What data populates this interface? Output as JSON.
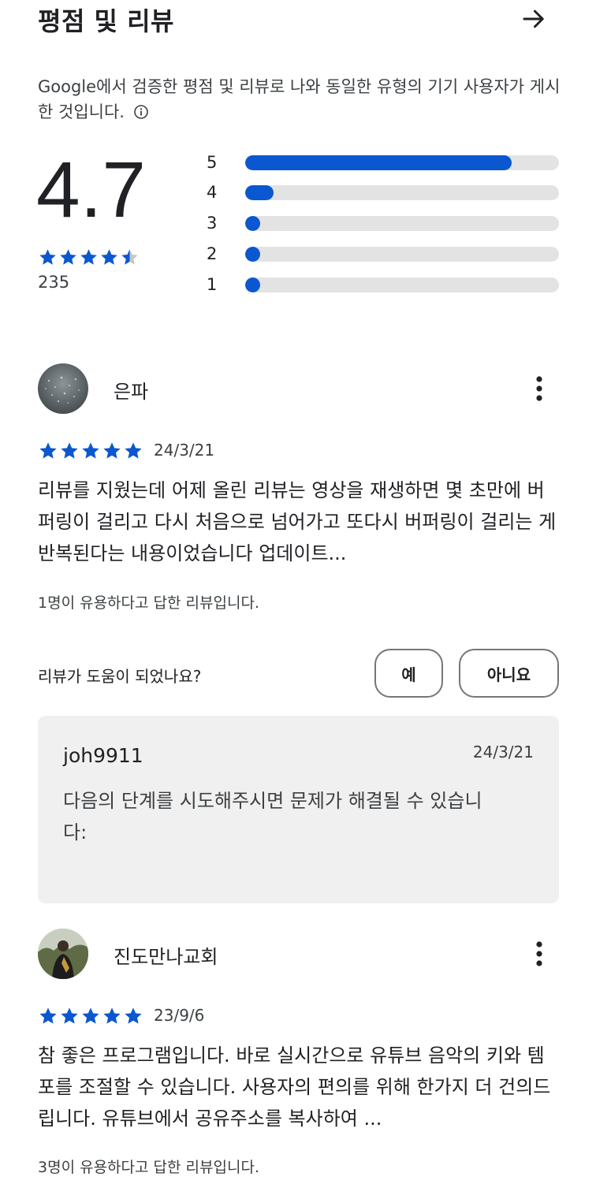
{
  "header": {
    "title": "평점 및 리뷰"
  },
  "description": {
    "text": "Google에서 검증한 평점 및 리뷰로 나와 동일한 유형의 기기 사용자가 게시한 것입니다."
  },
  "summary": {
    "average": "4.7",
    "stars_filled": 4.5,
    "total_count": "235"
  },
  "histogram": [
    {
      "label": "5",
      "fraction": 0.85
    },
    {
      "label": "4",
      "fraction": 0.09
    },
    {
      "label": "3",
      "fraction": 0.02
    },
    {
      "label": "2",
      "fraction": 0.02
    },
    {
      "label": "1",
      "fraction": 0.02
    }
  ],
  "reviews": [
    {
      "author": "은파",
      "rating": 5,
      "date": "24/3/21",
      "body": "리뷰를 지웠는데 어제 올린 리뷰는 영상을 재생하면 몇 초만에 버퍼링이 걸리고 다시 처음으로 넘어가고 또다시 버퍼링이 걸리는 게 반복된다는 내용이었습니다 업데이트...",
      "helpful": "1명이 유용하다고 답한 리뷰입니다.",
      "helpful_question": "리뷰가 도움이 되었나요?",
      "yes_label": "예",
      "no_label": "아니요",
      "reply": {
        "author": "joh9911",
        "date": "24/3/21",
        "text": "다음의 단계를 시도해주시면 문제가 해결될 수 있습니다:"
      }
    },
    {
      "author": "진도만나교회",
      "rating": 5,
      "date": "23/9/6",
      "body": "참 좋은 프로그램입니다. 바로 실시간으로 유튜브 음악의 키와 템포를 조절할 수 있습니다. 사용자의 편의를 위해 한가지 더 건의드립니다. 유튜브에서 공유주소를 복사하여 ...",
      "helpful": "3명이 유용하다고 답한 리뷰입니다."
    }
  ],
  "colors": {
    "accent": "#0b57d0",
    "track": "#e3e3e3",
    "reply_bg": "#f0f0f0"
  },
  "icons": [
    "arrow-right-icon",
    "info-icon",
    "star-icon",
    "more-vert-icon"
  ]
}
